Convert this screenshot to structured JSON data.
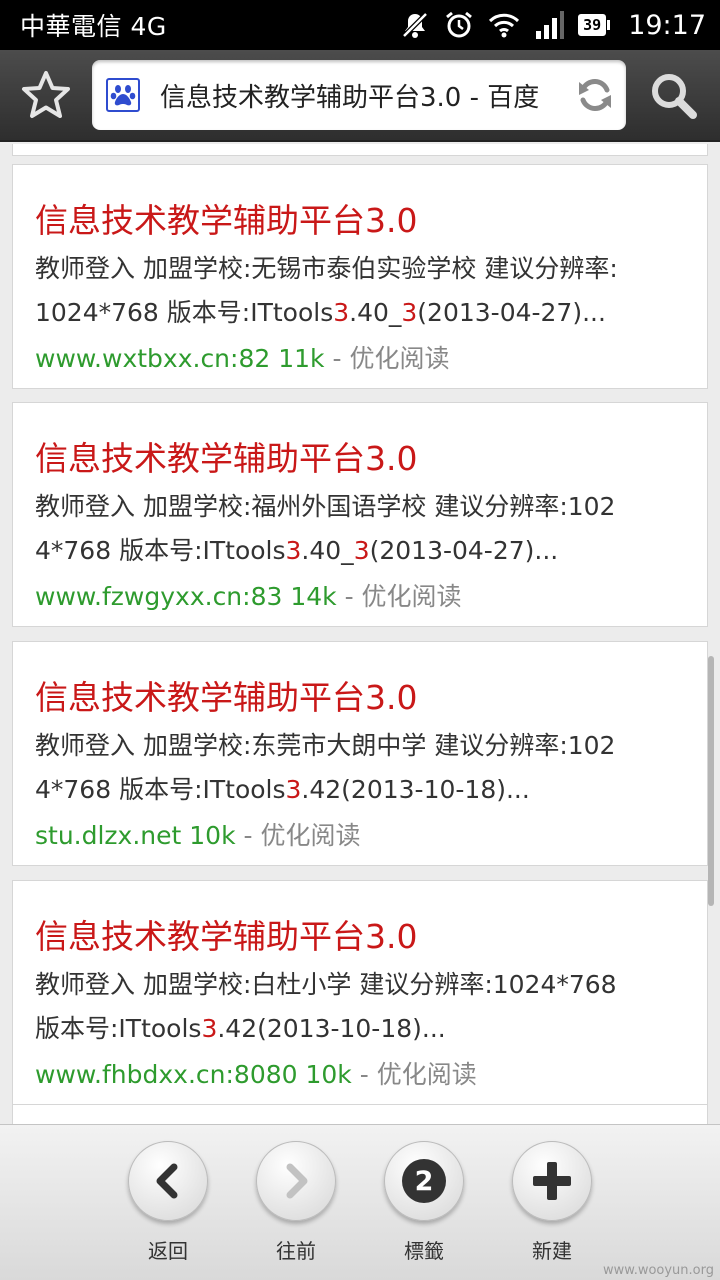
{
  "status_bar": {
    "carrier": "中華電信 4G",
    "battery": "39",
    "time": "19:17",
    "icons": [
      "mute-icon",
      "alarm-icon",
      "wifi-icon",
      "signal-icon",
      "battery-icon"
    ]
  },
  "toolbar": {
    "url_text": "信息技术教学辅助平台3.0 - 百度",
    "favicon": "baidu-paw-icon",
    "icons": [
      "star-icon",
      "refresh-icon",
      "search-icon"
    ]
  },
  "results": [
    {
      "title": "信息技术教学辅助平台3.0",
      "desc_line1": "教师登入 加盟学校:无锡市泰伯实验学校 建议分辨率:",
      "desc_l2_a": "1024*768 版本号:ITtools",
      "desc_l2_hl1": "3",
      "desc_l2_b": ".40_",
      "desc_l2_hl2": "3",
      "desc_l2_c": "(2013-04-27)...",
      "url": "www.wxtbxx.cn:82 11k",
      "sep": " - ",
      "option": "优化阅读"
    },
    {
      "title": "信息技术教学辅助平台3.0",
      "desc_line1": "教师登入 加盟学校:福州外国语学校 建议分辨率:102",
      "desc_l2_a": "4*768 版本号:ITtools",
      "desc_l2_hl1": "3",
      "desc_l2_b": ".40_",
      "desc_l2_hl2": "3",
      "desc_l2_c": "(2013-04-27)...",
      "url": "www.fzwgyxx.cn:83 14k",
      "sep": " - ",
      "option": "优化阅读"
    },
    {
      "title": "信息技术教学辅助平台3.0",
      "desc_line1": "教师登入 加盟学校:东莞市大朗中学 建议分辨率:102",
      "desc_l2_a": "4*768 版本号:ITtools",
      "desc_l2_hl1": "3",
      "desc_l2_b": ".42(2013-10-18)...",
      "desc_l2_hl2": "",
      "desc_l2_c": "",
      "url": "stu.dlzx.net 10k",
      "sep": " - ",
      "option": "优化阅读"
    },
    {
      "title": "信息技术教学辅助平台3.0",
      "desc_line1": "教师登入 加盟学校:白杜小学 建议分辨率:1024*768",
      "desc_l2_a": "版本号:ITtools",
      "desc_l2_hl1": "3",
      "desc_l2_b": ".42(2013-10-18)...",
      "desc_l2_hl2": "",
      "desc_l2_c": "",
      "url": "www.fhbdxx.cn:8080 10k",
      "sep": " - ",
      "option": "优化阅读"
    }
  ],
  "bottom_nav": {
    "back": "返回",
    "forward": "往前",
    "tabs": "標籤",
    "tab_count": "2",
    "new": "新建"
  },
  "watermark": "www.wooyun.org",
  "colors": {
    "title_red": "#c91818",
    "url_green": "#2e9b2e",
    "toolbar_dark": "#3a3a3a"
  }
}
